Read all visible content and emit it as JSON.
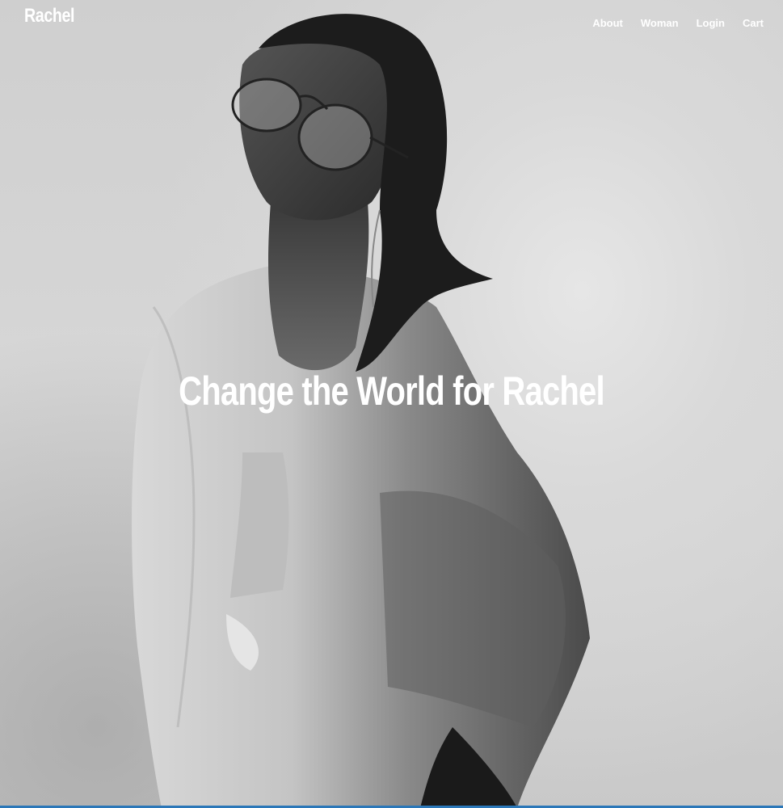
{
  "header": {
    "logo": "Rachel",
    "nav": [
      {
        "label": "About"
      },
      {
        "label": "Woman"
      },
      {
        "label": "Login"
      },
      {
        "label": "Cart"
      }
    ]
  },
  "hero": {
    "headline": "Change the World for Rachel",
    "image": "black-and-white portrait of a woman in aviator glasses and an oversized shirt"
  },
  "colors": {
    "text": "#ffffff",
    "backdrop": "#d3d3d3",
    "accent_bar": "#2b77b8"
  }
}
